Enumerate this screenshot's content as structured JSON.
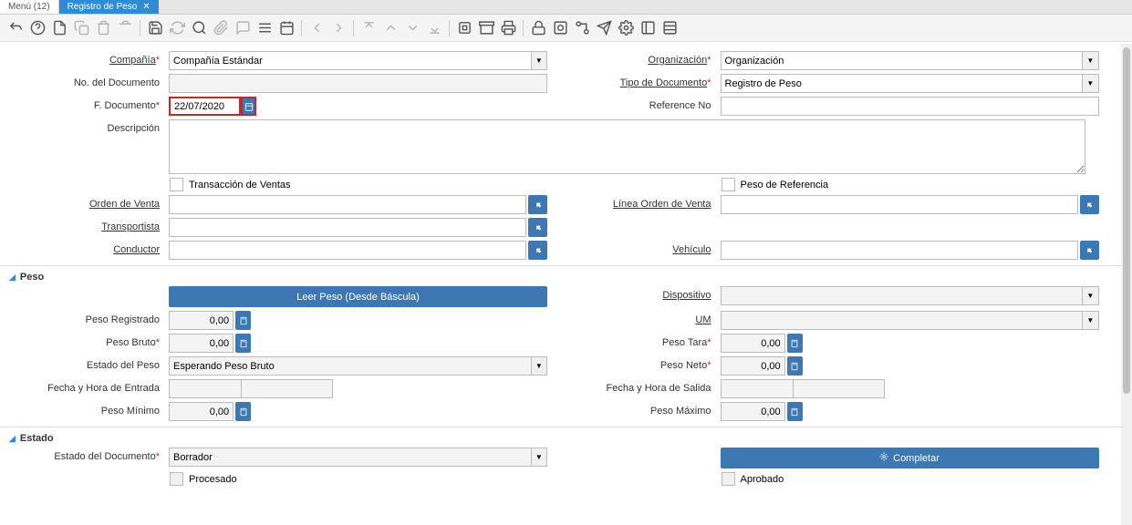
{
  "tabs": {
    "inactive": "Menú (12)",
    "active": "Registro de Peso"
  },
  "header": {
    "compania_label": "Compañía",
    "compania_value": "Compañía Estándar",
    "organizacion_label": "Organización",
    "organizacion_value": "Organización",
    "doc_no_label": "No. del Documento",
    "doc_no_value": "",
    "tipo_doc_label": "Tipo de Documento",
    "tipo_doc_value": "Registro de Peso",
    "f_doc_label": "F. Documento",
    "f_doc_value": "22/07/2020",
    "ref_no_label": "Reference No",
    "ref_no_value": "",
    "descripcion_label": "Descripción",
    "descripcion_value": "",
    "transaccion_ventas_label": "Transacción de Ventas",
    "peso_referencia_label": "Peso de Referencia",
    "orden_venta_label": "Orden de Venta",
    "orden_venta_value": "",
    "linea_orden_label": "Línea Orden de Venta",
    "linea_orden_value": "",
    "transportista_label": "Transportista",
    "transportista_value": "",
    "conductor_label": "Conductor",
    "conductor_value": "",
    "vehiculo_label": "Vehículo",
    "vehiculo_value": ""
  },
  "peso": {
    "section_label": "Peso",
    "leer_peso_label": "Leer Peso (Desde Báscula)",
    "dispositivo_label": "Dispositivo",
    "dispositivo_value": "",
    "peso_registrado_label": "Peso Registrado",
    "peso_registrado_value": "0,00",
    "um_label": "UM",
    "um_value": "",
    "peso_bruto_label": "Peso Bruto",
    "peso_bruto_value": "0,00",
    "peso_tara_label": "Peso Tara",
    "peso_tara_value": "0,00",
    "estado_peso_label": "Estado del Peso",
    "estado_peso_value": "Esperando Peso Bruto",
    "peso_neto_label": "Peso Neto",
    "peso_neto_value": "0,00",
    "fecha_entrada_label": "Fecha y Hora de Entrada",
    "fecha_salida_label": "Fecha y Hora de Salida",
    "peso_minimo_label": "Peso Mínimo",
    "peso_minimo_value": "0,00",
    "peso_maximo_label": "Peso Máximo",
    "peso_maximo_value": "0,00"
  },
  "estado": {
    "section_label": "Estado",
    "estado_doc_label": "Estado del Documento",
    "estado_doc_value": "Borrador",
    "completar_label": "Completar",
    "procesado_label": "Procesado",
    "aprobado_label": "Aprobado"
  }
}
